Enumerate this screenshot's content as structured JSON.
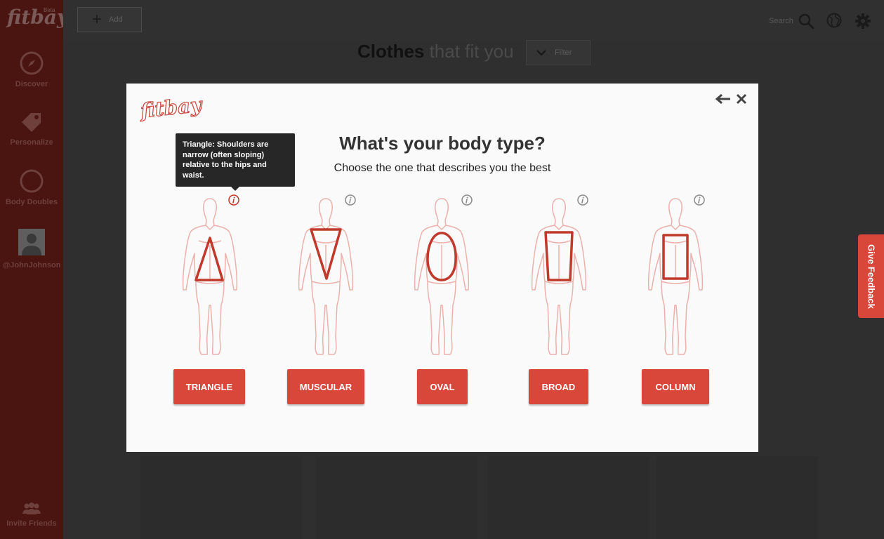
{
  "app": {
    "logo": "fitbay",
    "beta_label": "Beta"
  },
  "sidebar": {
    "items": [
      {
        "label": "Discover",
        "icon": "compass-icon"
      },
      {
        "label": "Personalize",
        "icon": "tag-icon"
      },
      {
        "label": "Body Doubles",
        "icon": "circle-icon"
      },
      {
        "label": "@JohnJohnson",
        "icon": "avatar-icon"
      }
    ],
    "invite": {
      "label": "Invite Friends",
      "icon": "people-icon"
    }
  },
  "topbar": {
    "add_label": "Add",
    "search_label": "Search",
    "icons": [
      "search-icon",
      "globe-icon",
      "gear-icon"
    ]
  },
  "page": {
    "heading_bold": "Clothes",
    "heading_rest": " that fit you",
    "filter_label": "Filter"
  },
  "feedback": {
    "label": "Give Feedback"
  },
  "modal": {
    "logo": "fitbay",
    "title": "What's your body type?",
    "subtitle": "Choose the one that describes you the best",
    "tooltip": "Triangle: Shoulders are narrow (often sloping) relative to the hips and waist.",
    "body_types": [
      {
        "label": "TRIANGLE",
        "shape": "triangle"
      },
      {
        "label": "MUSCULAR",
        "shape": "inverted-triangle"
      },
      {
        "label": "OVAL",
        "shape": "oval"
      },
      {
        "label": "BROAD",
        "shape": "trapezoid"
      },
      {
        "label": "COLUMN",
        "shape": "rectangle"
      }
    ]
  },
  "colors": {
    "accent": "#d9463a",
    "sidebar": "#4a1511",
    "overlay": "#2f2f2f",
    "modal_bg": "#fafafa",
    "tooltip_bg": "#272727"
  }
}
